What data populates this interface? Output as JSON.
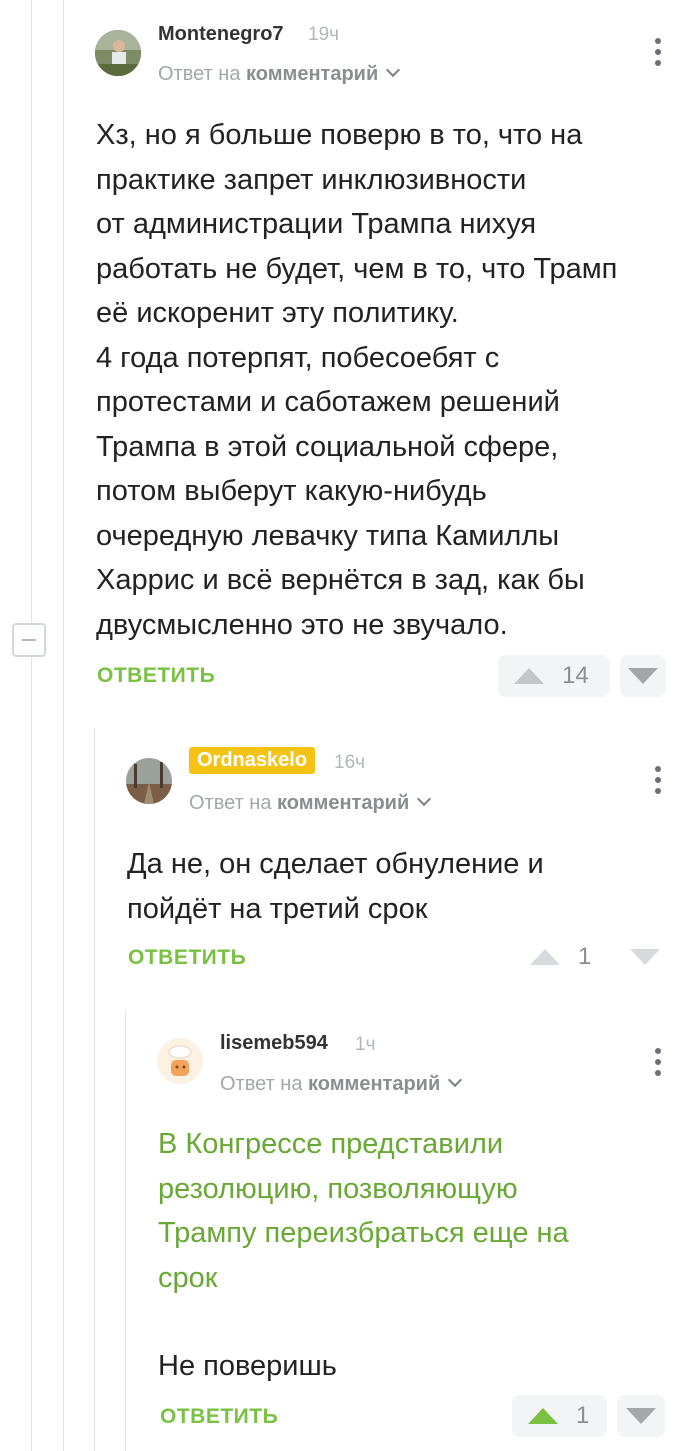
{
  "comments": [
    {
      "username": "Montenegro7",
      "time": "19ч",
      "reply_to_prefix": "Ответ на",
      "reply_to_target": "комментарий",
      "text_lines": [
        "Хз, но я больше поверю в то, что на",
        "практике запрет инклюзивности",
        "от администрации Трампа нихуя",
        "работать не будет, чем в то, что Трамп",
        "её искоренит эту политику.",
        "4 года потерпят, побесоебят с",
        "протестами и саботажем решений",
        "Трампа в этой социальной сфере,",
        "потом выберут какую-нибудь",
        "очередную левачку типа Камиллы",
        "Харрис и всё вернётся в зад, как бы",
        "двусмысленно это не звучало."
      ],
      "reply_label": "ОТВЕТИТЬ",
      "rating": "14"
    },
    {
      "username": "Ordnaskelo",
      "time": "16ч",
      "reply_to_prefix": "Ответ на",
      "reply_to_target": "комментарий",
      "text_lines": [
        "Да не, он сделает обнуление и",
        "пойдёт на третий срок"
      ],
      "reply_label": "ОТВЕТИТЬ",
      "rating": "1"
    },
    {
      "username": "lisemeb594",
      "time": "1ч",
      "reply_to_prefix": "Ответ на",
      "reply_to_target": "комментарий",
      "quote_lines": [
        "В Конгрессе представили",
        "резолюцию, позволяющую",
        "Трампу переизбраться еще на",
        "срок"
      ],
      "text_lines": [
        "Не поверишь"
      ],
      "reply_label": "ОТВЕТИТЬ",
      "rating": "1"
    }
  ],
  "colors": {
    "accent": "#7ac143",
    "badge": "#f5c314",
    "quote": "#6aa836"
  }
}
